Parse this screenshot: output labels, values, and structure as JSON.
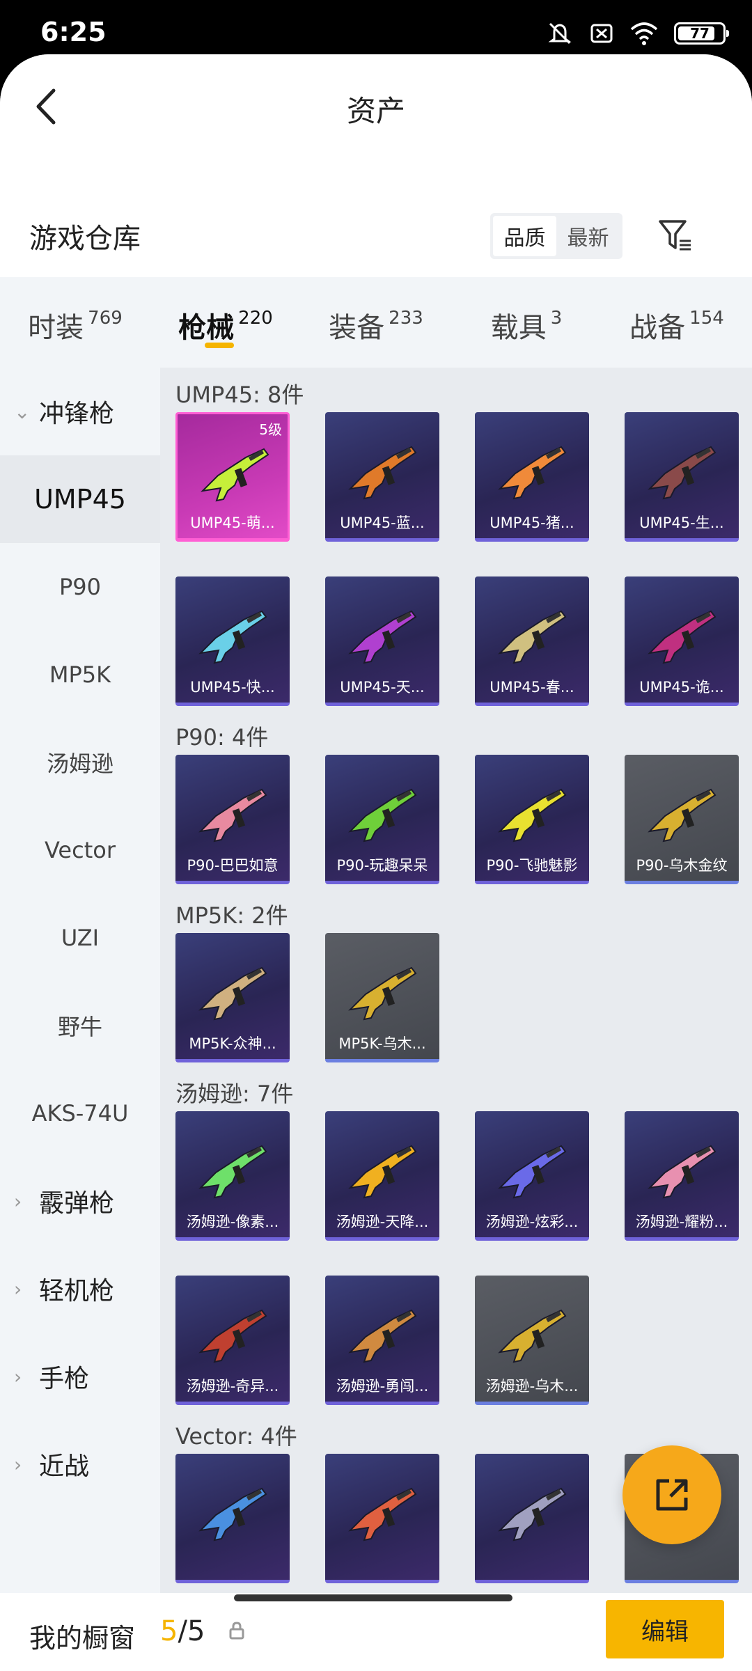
{
  "status": {
    "time": "6:25",
    "battery": "77"
  },
  "header": {
    "title": "资产",
    "section": "游戏仓库",
    "sort": [
      "品质",
      "最新"
    ]
  },
  "tabs": [
    {
      "label": "时装",
      "count": "769"
    },
    {
      "label": "枪械",
      "count": "220",
      "active": true
    },
    {
      "label": "装备",
      "count": "233"
    },
    {
      "label": "载具",
      "count": "3"
    },
    {
      "label": "战备",
      "count": "154"
    }
  ],
  "sidebar": [
    {
      "label": "冲锋枪",
      "type": "group",
      "expanded": true
    },
    {
      "label": "UMP45",
      "active": true
    },
    {
      "label": "P90"
    },
    {
      "label": "MP5K"
    },
    {
      "label": "汤姆逊"
    },
    {
      "label": "Vector"
    },
    {
      "label": "UZI"
    },
    {
      "label": "野牛"
    },
    {
      "label": "AKS-74U"
    },
    {
      "label": "霰弹枪",
      "type": "group"
    },
    {
      "label": "轻机枪",
      "type": "group"
    },
    {
      "label": "手枪",
      "type": "group"
    },
    {
      "label": "近战",
      "type": "group"
    }
  ],
  "groups": [
    {
      "title": "UMP45: 8件",
      "items": [
        {
          "name": "UMP45-萌...",
          "level": "5级",
          "rarity": "pink",
          "color": "#c6ef3a"
        },
        {
          "name": "UMP45-蓝...",
          "rarity": "purple",
          "color": "#e07a2a"
        },
        {
          "name": "UMP45-猪...",
          "rarity": "purple",
          "color": "#f08a3a"
        },
        {
          "name": "UMP45-生...",
          "rarity": "purple",
          "color": "#8a4a4a"
        },
        {
          "name": "UMP45-快...",
          "rarity": "purple",
          "color": "#6ad0e8"
        },
        {
          "name": "UMP45-天...",
          "rarity": "purple",
          "color": "#b040d0"
        },
        {
          "name": "UMP45-春...",
          "rarity": "purple",
          "color": "#d0c080"
        },
        {
          "name": "UMP45-诡...",
          "rarity": "purple",
          "color": "#c03080"
        }
      ]
    },
    {
      "title": "P90: 4件",
      "items": [
        {
          "name": "P90-巴巴如意",
          "rarity": "purple",
          "color": "#e88aa0"
        },
        {
          "name": "P90-玩趣呆呆",
          "rarity": "purple",
          "color": "#6fd03a"
        },
        {
          "name": "P90-飞驰魅影",
          "rarity": "purple",
          "color": "#e8e030"
        },
        {
          "name": "P90-乌木金纹",
          "rarity": "gray",
          "color": "#d8b030"
        }
      ]
    },
    {
      "title": "MP5K: 2件",
      "items": [
        {
          "name": "MP5K-众神...",
          "rarity": "purple",
          "color": "#d0b080"
        },
        {
          "name": "MP5K-乌木...",
          "rarity": "gray",
          "color": "#d8b030"
        }
      ]
    },
    {
      "title": "汤姆逊: 7件",
      "items": [
        {
          "name": "汤姆逊-像素...",
          "rarity": "purple",
          "color": "#6ee06a"
        },
        {
          "name": "汤姆逊-天降...",
          "rarity": "purple",
          "color": "#f0b020"
        },
        {
          "name": "汤姆逊-炫彩...",
          "rarity": "purple",
          "color": "#6a6ae8"
        },
        {
          "name": "汤姆逊-耀粉...",
          "rarity": "purple",
          "color": "#e890b0"
        },
        {
          "name": "汤姆逊-奇异...",
          "rarity": "purple",
          "color": "#c04030"
        },
        {
          "name": "汤姆逊-勇闯...",
          "rarity": "purple",
          "color": "#d08a40"
        },
        {
          "name": "汤姆逊-乌木...",
          "rarity": "gray",
          "color": "#d8b030"
        }
      ]
    },
    {
      "title": "Vector: 4件",
      "items": [
        {
          "name": "",
          "rarity": "purple",
          "color": "#4a90e0"
        },
        {
          "name": "",
          "rarity": "purple",
          "color": "#e06040"
        },
        {
          "name": "",
          "rarity": "purple",
          "color": "#a0a0c0"
        },
        {
          "name": "",
          "rarity": "gray",
          "color": "#d8b030"
        }
      ]
    }
  ],
  "bottom": {
    "label": "我的橱窗",
    "current": "5",
    "sep": "/",
    "total": "5",
    "edit": "编辑"
  },
  "colors": {
    "accent": "#f5b400",
    "fab": "#f6a81a"
  }
}
